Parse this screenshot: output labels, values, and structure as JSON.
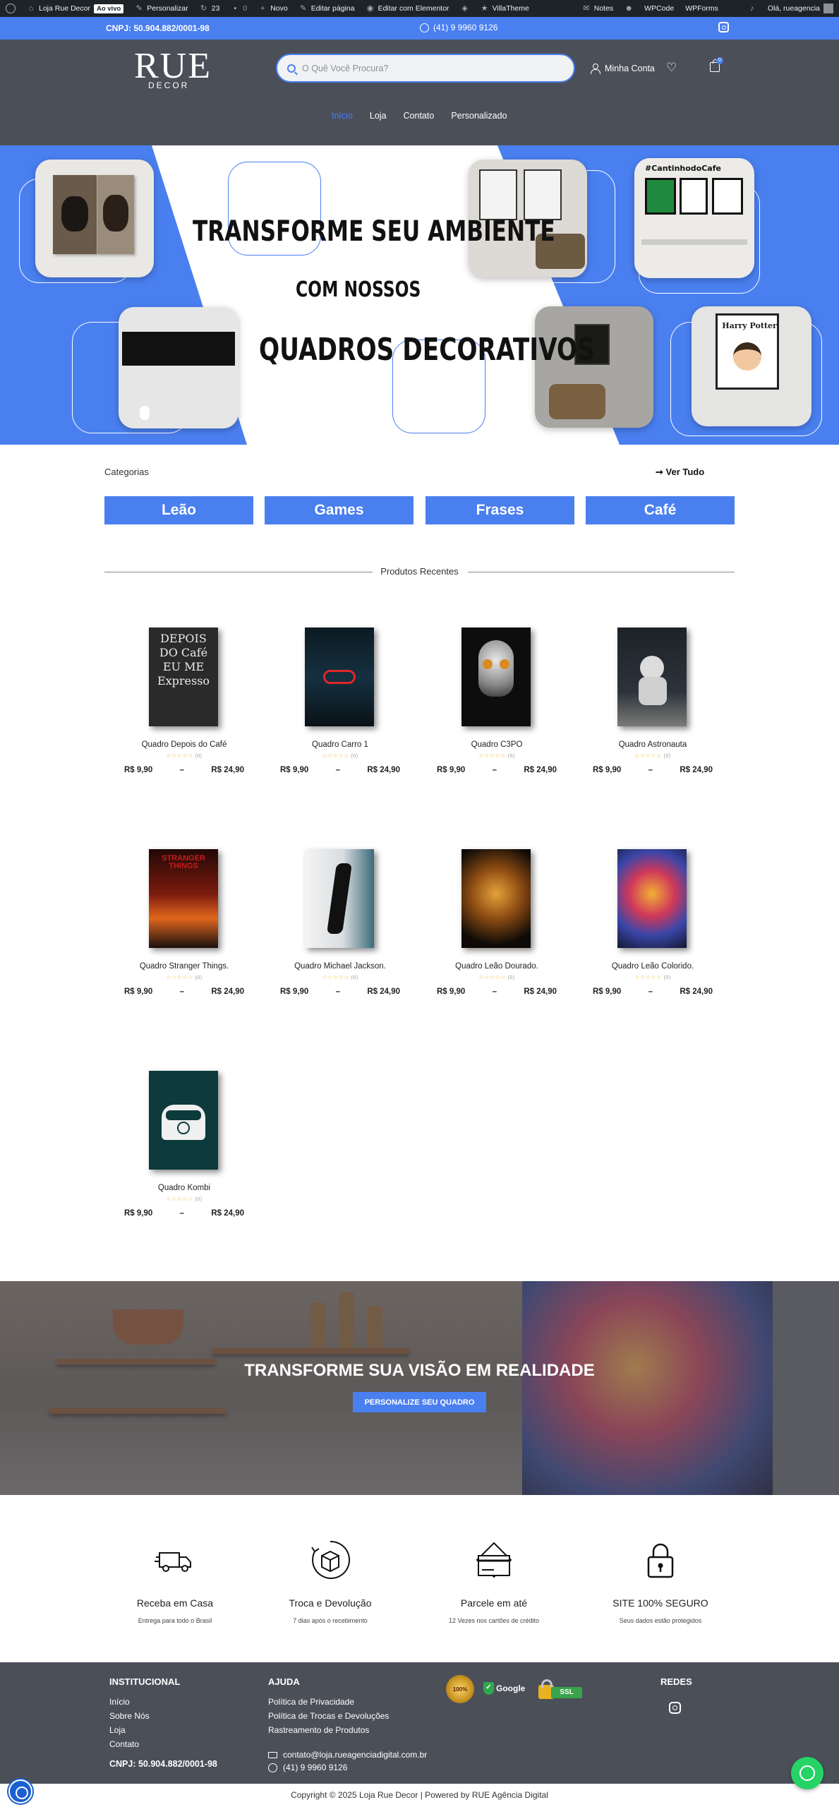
{
  "adminbar": {
    "site_name": "Loja Rue Decor",
    "live_badge": "Ao vivo",
    "customize": "Personalizar",
    "updates_count": "23",
    "comments_count": "0",
    "new": "Novo",
    "edit_page": "Editar página",
    "edit_elementor": "Editar com Elementor",
    "villatheme": "VillaTheme",
    "notes": "Notes",
    "wpcode": "WPCode",
    "wpforms": "WPForms",
    "greeting": "Olá, rueagencia"
  },
  "topbar": {
    "cnpj": "CNPJ: 50.904.882/0001-98",
    "phone": "(41) 9 9960 9126"
  },
  "header": {
    "logo_main": "RUE",
    "logo_sub": "DECOR",
    "search_placeholder": "O Quê Você Procura?",
    "account_label": "Minha Conta",
    "cart_count": "0"
  },
  "nav": {
    "items": [
      "Início",
      "Loja",
      "Contato",
      "Personalizado"
    ]
  },
  "hero": {
    "line1": "TRANSFORME SEU AMBIENTE",
    "line2": "COM NOSSOS",
    "line3": "QUADROS DECORATIVOS",
    "frame_texts": {
      "cafe_sign": "#CantinhodoCafe",
      "harry": "Harry Potter"
    }
  },
  "categories": {
    "heading": "Categorias",
    "see_all": "➞ Ver Tudo",
    "items": [
      "Leão",
      "Games",
      "Frases",
      "Café"
    ]
  },
  "recent": {
    "heading": "Produtos Recentes"
  },
  "products": [
    {
      "name": "Quadro Depois do Café",
      "rating": "(0)",
      "price_min": "R$ 9,90",
      "sep": "–",
      "price_max": "R$ 24,90",
      "art_text": "DEPOIS DO Café EU ME Expresso"
    },
    {
      "name": "Quadro Carro 1",
      "rating": "(0)",
      "price_min": "R$ 9,90",
      "sep": "–",
      "price_max": "R$ 24,90"
    },
    {
      "name": "Quadro C3PO",
      "rating": "(0)",
      "price_min": "R$ 9,90",
      "sep": "–",
      "price_max": "R$ 24,90"
    },
    {
      "name": "Quadro Astronauta",
      "rating": "(0)",
      "price_min": "R$ 9,90",
      "sep": "–",
      "price_max": "R$ 24,90"
    },
    {
      "name": "Quadro Stranger Things.",
      "rating": "(0)",
      "price_min": "R$ 9,90",
      "sep": "–",
      "price_max": "R$ 24,90",
      "art_text": "STRANGER THINGS"
    },
    {
      "name": "Quadro Michael Jackson.",
      "rating": "(0)",
      "price_min": "R$ 9,90",
      "sep": "–",
      "price_max": "R$ 24,90"
    },
    {
      "name": "Quadro Leão Dourado.",
      "rating": "(0)",
      "price_min": "R$ 9,90",
      "sep": "–",
      "price_max": "R$ 24,90"
    },
    {
      "name": "Quadro Leão Colorido.",
      "rating": "(0)",
      "price_min": "R$ 9,90",
      "sep": "–",
      "price_max": "R$ 24,90"
    },
    {
      "name": "Quadro Kombi",
      "rating": "(0)",
      "price_min": "R$ 9,90",
      "sep": "–",
      "price_max": "R$ 24,90"
    }
  ],
  "banner": {
    "title": "TRANSFORME SUA VISÃO EM REALIDADE",
    "button": "PERSONALIZE SEU QUADRO"
  },
  "features": [
    {
      "title": "Receba em Casa",
      "subtitle": "Entrega para todo o Brasil",
      "icon": "truck-icon"
    },
    {
      "title": "Troca e Devolução",
      "subtitle": "7 dias após o recebimento",
      "icon": "return-box-icon"
    },
    {
      "title": "Parcele em até",
      "subtitle": "12 Vezes nos cartões de crédito",
      "icon": "credit-card-icon"
    },
    {
      "title": "SITE 100% SEGURO",
      "subtitle": "Seus dados estão protegidos",
      "icon": "padlock-icon"
    }
  ],
  "footer": {
    "institucional_title": "INSTITUCIONAL",
    "institucional": [
      "Início",
      "Sobre Nós",
      "Loja",
      "Contato"
    ],
    "cnpj": "CNPJ: 50.904.882/0001-98",
    "ajuda_title": "AJUDA",
    "ajuda": [
      "Política de Privacidade",
      "Política de Trocas e Devoluções",
      "Rastreamento de Produtos"
    ],
    "email": "contato@loja.rueagenciadigital.com.br",
    "phone": "(41) 9 9960 9126",
    "badge_100": "100%",
    "badge_google": "Google",
    "badge_ssl": "SSL",
    "redes_title": "REDES",
    "copyright": "Copyright © 2025 Loja Rue Decor | Powered by RUE Agência Digital"
  },
  "colors": {
    "brand_blue": "#4a7ff0",
    "header_gray": "#4b4f58",
    "whatsapp_green": "#25d366"
  }
}
